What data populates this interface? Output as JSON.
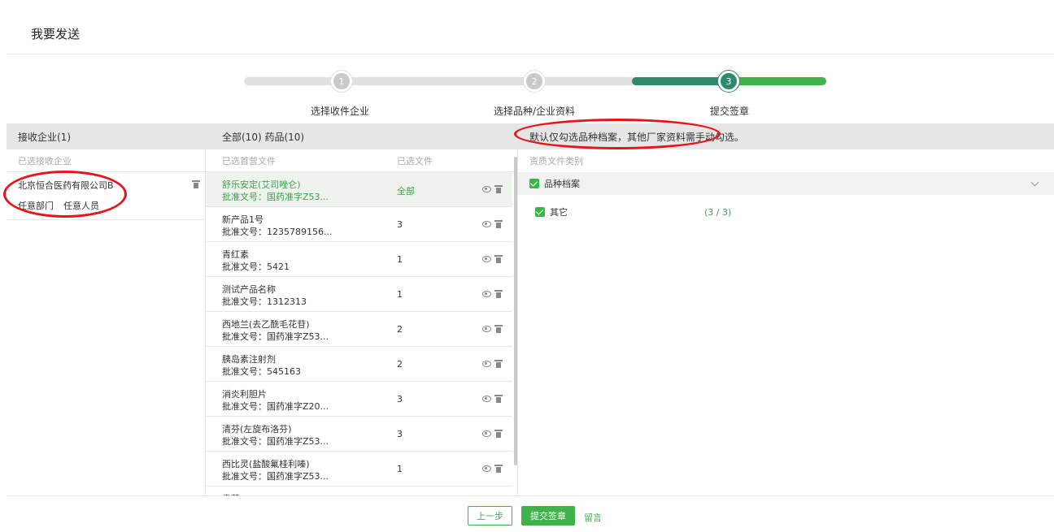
{
  "page": {
    "title": "我要发送"
  },
  "stepper": {
    "steps": [
      {
        "number": "1",
        "label": "选择收件企业"
      },
      {
        "number": "2",
        "label": "选择品种/企业资料"
      },
      {
        "number": "3",
        "label": "提交签章"
      }
    ],
    "current_step": 3
  },
  "left": {
    "header": "接收企业(1)",
    "subheader": "已选接收企业",
    "recipient": {
      "company": "北京恒合医药有限公司B",
      "department": "任意部门",
      "person": "任意人员"
    }
  },
  "middle": {
    "header": "全部(10)  药品(10)",
    "col_file": "已选首营文件",
    "col_selected": "已选文件",
    "rows": [
      {
        "name": "舒乐安定(艾司唑仑)",
        "approval": "批准文号：国药准字Z53...",
        "count": "全部",
        "selected": true
      },
      {
        "name": "新产品1号",
        "approval": "批准文号：1235789156...",
        "count": "3"
      },
      {
        "name": "青红素",
        "approval": "批准文号：5421",
        "count": "1"
      },
      {
        "name": "测试产品名称",
        "approval": "批准文号：1312313",
        "count": "1"
      },
      {
        "name": "西地兰(去乙酰毛花苷)",
        "approval": "批准文号：国药准字Z53...",
        "count": "2"
      },
      {
        "name": "胰岛素注射剂",
        "approval": "批准文号：545163",
        "count": "2"
      },
      {
        "name": "消炎利胆片",
        "approval": "批准文号：国药准字Z20...",
        "count": "3"
      },
      {
        "name": "清芬(左旋布洛芬)",
        "approval": "批准文号：国药准字Z53...",
        "count": "3"
      },
      {
        "name": "西比灵(盐酸氟桂利嗪)",
        "approval": "批准文号：国药准字Z53...",
        "count": "1"
      },
      {
        "name": "贵蔗",
        "approval": "",
        "count": ""
      }
    ]
  },
  "right": {
    "notice": "默认仅勾选品种档案，其他厂家资料需手动勾选。",
    "subheader": "资质文件类别",
    "category": "品种档案",
    "item": {
      "label": "其它",
      "ratio": "(3 / 3)"
    }
  },
  "footer": {
    "prev_label": "上一步",
    "submit_label": "提交签章",
    "message_label": "留言"
  },
  "colors": {
    "accent": "#3db34a",
    "accent_dark": "#2d8a6a",
    "annotation": "#e8141c"
  }
}
